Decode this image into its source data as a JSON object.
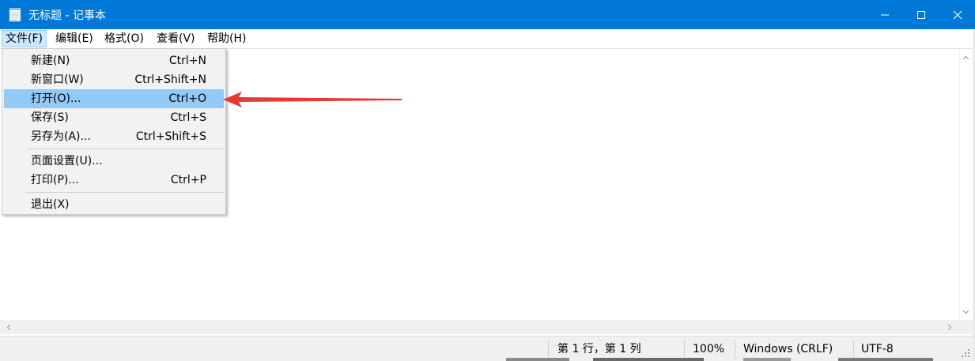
{
  "window": {
    "title": "无标题 - 记事本",
    "app_icon": "notepad-icon",
    "controls": {
      "minimize": "minimize-icon",
      "maximize": "maximize-icon",
      "close": "close-icon"
    }
  },
  "menubar": {
    "items": [
      {
        "label": "文件(F)"
      },
      {
        "label": "编辑(E)"
      },
      {
        "label": "格式(O)"
      },
      {
        "label": "查看(V)"
      },
      {
        "label": "帮助(H)"
      }
    ]
  },
  "file_menu": {
    "items": [
      {
        "label": "新建(N)",
        "shortcut": "Ctrl+N"
      },
      {
        "label": "新窗口(W)",
        "shortcut": "Ctrl+Shift+N"
      },
      {
        "label": "打开(O)...",
        "shortcut": "Ctrl+O",
        "highlighted": true
      },
      {
        "label": "保存(S)",
        "shortcut": "Ctrl+S"
      },
      {
        "label": "另存为(A)...",
        "shortcut": "Ctrl+Shift+S"
      },
      {
        "label": "页面设置(U)...",
        "shortcut": ""
      },
      {
        "label": "打印(P)...",
        "shortcut": "Ctrl+P"
      },
      {
        "label": "退出(X)",
        "shortcut": ""
      }
    ]
  },
  "editor": {
    "content": ""
  },
  "statusbar": {
    "position": "第 1 行，第 1 列",
    "zoom": "100%",
    "line_ending": "Windows (CRLF)",
    "encoding": "UTF-8"
  },
  "colors": {
    "titlebar": "#0078d7",
    "menu_highlight": "#91c9f7",
    "menu_active": "#cce8ff",
    "arrow": "#e53935"
  }
}
